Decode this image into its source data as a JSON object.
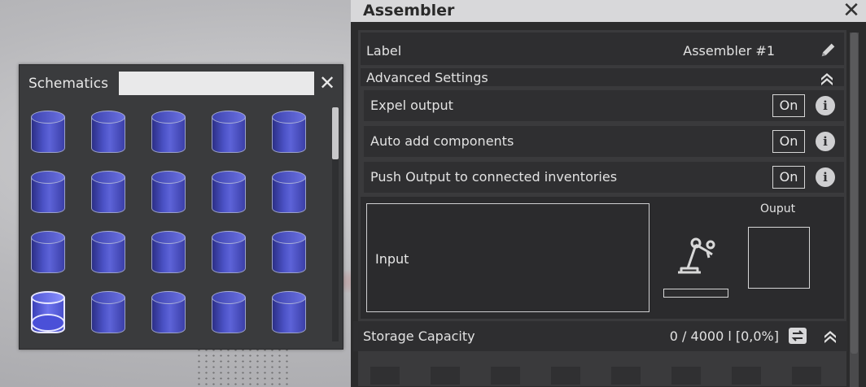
{
  "schematics": {
    "title": "Schematics",
    "search": {
      "value": "",
      "placeholder": ""
    },
    "item_icon": "cylinder-part-icon",
    "rows": 4,
    "cols": 5
  },
  "assembler": {
    "title": "Assembler",
    "label_row": {
      "label": "Label",
      "value": "Assembler #1"
    },
    "advanced_settings": {
      "label": "Advanced Settings"
    },
    "settings": [
      {
        "label": "Expel output",
        "state": "On"
      },
      {
        "label": "Auto add components",
        "state": "On"
      },
      {
        "label": "Push Output to connected inventories",
        "state": "On"
      }
    ],
    "input": {
      "label": "Input"
    },
    "output": {
      "label": "Ouput"
    },
    "progress": 0,
    "storage": {
      "label": "Storage Capacity",
      "value": "0 / 4000 l [0,0%]"
    },
    "info_glyph": "i"
  },
  "colors": {
    "accent": "#4b52c6",
    "panel": "#3a3b3d",
    "titlebar": "#d8d8da"
  }
}
